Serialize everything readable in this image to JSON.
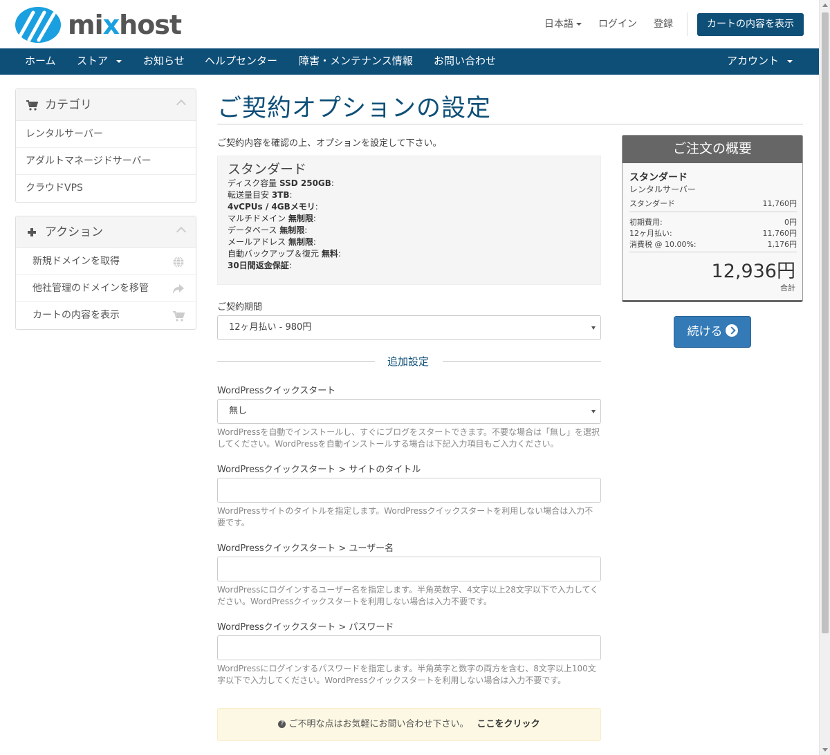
{
  "header": {
    "logo_text_a": "mi",
    "logo_text_x": "x",
    "logo_text_b": "host",
    "lang": "日本語",
    "login": "ログイン",
    "register": "登録",
    "cart_button": "カートの内容を表示"
  },
  "nav": {
    "home": "ホーム",
    "store": "ストア",
    "news": "お知らせ",
    "help": "ヘルプセンター",
    "maintenance": "障害・メンテナンス情報",
    "contact": "お問い合わせ",
    "account": "アカウント"
  },
  "sidebar": {
    "categories_title": "カテゴリ",
    "categories": [
      "レンタルサーバー",
      "アダルトマネージドサーバー",
      "クラウドVPS"
    ],
    "actions_title": "アクション",
    "actions": [
      "新規ドメインを取得",
      "他社管理のドメインを移管",
      "カートの内容を表示"
    ]
  },
  "main": {
    "title": "ご契約オプションの設定",
    "intro": "ご契約内容を確認の上、オプションを設定して下さい。",
    "product": {
      "name": "スタンダード",
      "features": [
        {
          "label": "ディスク容量 ",
          "value": "SSD 250GB",
          "suffix": ":"
        },
        {
          "label": "転送量目安 ",
          "value": "3TB",
          "suffix": ":"
        },
        {
          "label": "",
          "value": "4vCPUs / 4GBメモリ",
          "suffix": ":"
        },
        {
          "label": "マルチドメイン ",
          "value": "無制限",
          "suffix": ":"
        },
        {
          "label": "データベース ",
          "value": "無制限",
          "suffix": ":"
        },
        {
          "label": "メールアドレス ",
          "value": "無制限",
          "suffix": ":"
        },
        {
          "label": "自動バックアップ＆復元 ",
          "value": "無料",
          "suffix": ":"
        },
        {
          "label": "",
          "value": "30日間返金保証",
          "suffix": ":"
        }
      ]
    },
    "period_label": "ご契約期間",
    "period_value": "12ヶ月払い - 980円",
    "additional_title": "追加設定",
    "wp_quickstart_label": "WordPressクイックスタート",
    "wp_quickstart_value": "無し",
    "wp_quickstart_help": "WordPressを自動でインストールし、すぐにブログをスタートできます。不要な場合は「無し」を選択してください。WordPressを自動インストールする場合は下記入力項目もご入力ください。",
    "site_title_label": "WordPressクイックスタート > サイトのタイトル",
    "site_title_help": "WordPressサイトのタイトルを指定します。WordPressクイックスタートを利用しない場合は入力不要です。",
    "username_label": "WordPressクイックスタート > ユーザー名",
    "username_help": "WordPressにログインするユーザー名を指定します。半角英数字、4文字以上28文字以下で入力してください。WordPressクイックスタートを利用しない場合は入力不要です。",
    "password_label": "WordPressクイックスタート > パスワード",
    "password_help": "WordPressにログインするパスワードを指定します。半角英字と数字の両方を含む、8文字以上100文字以下で入力してください。WordPressクイックスタートを利用しない場合は入力不要です。",
    "notice_text": "ご不明な点はお気軽にお問い合わせ下さい。",
    "notice_link": "ここをクリック"
  },
  "summary": {
    "title": "ご注文の概要",
    "product": "スタンダード",
    "category": "レンタルサーバー",
    "line_label": "スタンダード",
    "line_value": "11,760円",
    "setup_label": "初期費用:",
    "setup_value": "0円",
    "cycle_label": "12ヶ月払い:",
    "cycle_value": "11,760円",
    "tax_label": "消費税 @ 10.00%:",
    "tax_value": "1,176円",
    "total": "12,936円",
    "total_label": "合計",
    "continue": "続ける"
  },
  "colors": {
    "brand": "#0e4f78",
    "button": "#337ab7",
    "logo_accent": "#1aa0e0"
  }
}
